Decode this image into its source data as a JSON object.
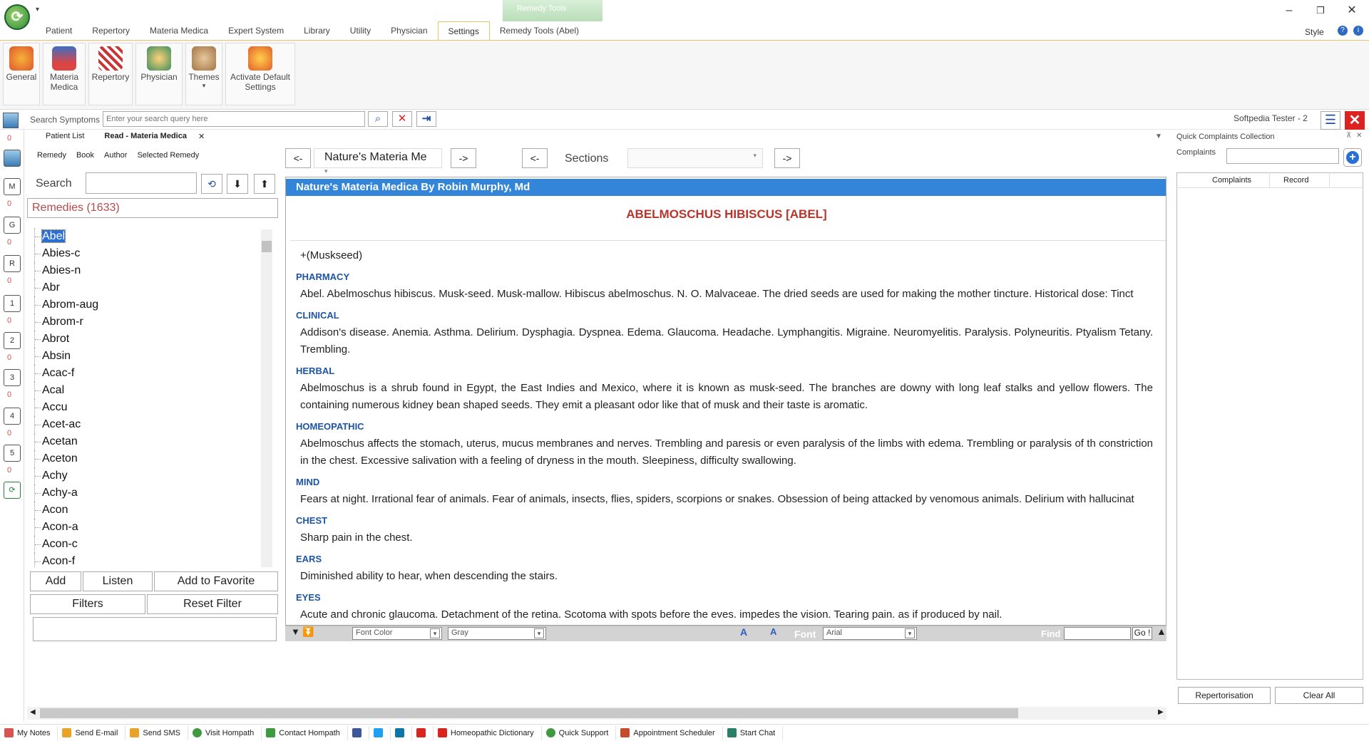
{
  "titlebar": {
    "context_tab": "Remedy Tools",
    "minimize": "–",
    "restore": "❐",
    "close": "✕"
  },
  "ribbon_tabs": [
    "Patient",
    "Repertory",
    "Materia Medica",
    "Expert System",
    "Library",
    "Utility",
    "Physician",
    "Settings",
    "Remedy Tools (Abel)"
  ],
  "active_tab": "Settings",
  "style_label": "Style",
  "ribbon_buttons": [
    {
      "label": "General"
    },
    {
      "label": "Materia Medica"
    },
    {
      "label": "Repertory"
    },
    {
      "label": "Physician"
    },
    {
      "label": "Themes"
    },
    {
      "label": "Activate Default Settings"
    }
  ],
  "search": {
    "label": "Search Symptoms",
    "placeholder": "Enter your search query here",
    "user": "Softpedia Tester - 2"
  },
  "left_strip": {
    "buttons": [
      "M",
      "G",
      "R",
      "1",
      "2",
      "3",
      "4",
      "5"
    ],
    "count": "0"
  },
  "doc_tabs": [
    "Patient List",
    "Read - Materia Medica"
  ],
  "remedy_panel": {
    "subtabs": [
      "Remedy",
      "Book",
      "Author",
      "Selected Remedy"
    ],
    "search_label": "Search",
    "count_label": "Remedies (1633)",
    "remedies": [
      "Abel",
      "Abies-c",
      "Abies-n",
      "Abr",
      "Abrom-aug",
      "Abrom-r",
      "Abrot",
      "Absin",
      "Acac-f",
      "Acal",
      "Accu",
      "Acet-ac",
      "Acetan",
      "Aceton",
      "Achy",
      "Achy-a",
      "Acon",
      "Acon-a",
      "Acon-c",
      "Acon-f"
    ],
    "selected": "Abel",
    "buttons": {
      "add": "Add",
      "listen": "Listen",
      "favorite": "Add to Favorite",
      "filters": "Filters",
      "reset": "Reset Filter"
    }
  },
  "reader": {
    "prev": "<-",
    "next": "->",
    "book_select": "Nature's Materia Me",
    "sections_label": "Sections",
    "book_header": "Nature's Materia Medica By Robin Murphy, Md",
    "remedy_title": "ABELMOSCHUS HIBISCUS [ABEL]",
    "aka": "+(Muskseed)",
    "sections": [
      {
        "heading": "PHARMACY",
        "text": "Abel. Abelmoschus hibiscus. Musk-seed. Musk-mallow. Hibiscus abelmoschus. N. O. Malvaceae. The dried seeds are used for making the mother tincture. Historical dose: Tinct"
      },
      {
        "heading": "CLINICAL",
        "text": "Addison's disease. Anemia. Asthma. Delirium. Dysphagia. Dyspnea. Edema. Glaucoma. Headache. Lymphangitis. Migraine. Neuromyelitis. Paralysis. Polyneuritis. Ptyalism Tetany. Trembling."
      },
      {
        "heading": "HERBAL",
        "text": "Abelmoschus is a shrub found in Egypt, the East Indies and Mexico, where it is known as musk-seed. The branches are downy with long leaf stalks and yellow flowers. The containing numerous kidney bean shaped seeds. They emit a pleasant odor like that of musk and their taste is aromatic."
      },
      {
        "heading": "HOMEOPATHIC",
        "text": "Abelmoschus affects the stomach, uterus, mucus membranes and nerves. Trembling and paresis or even paralysis of the limbs with edema. Trembling or paralysis of th constriction in the chest. Excessive salivation with a feeling of dryness in the mouth. Sleepiness, difficulty swallowing."
      },
      {
        "heading": "MIND",
        "text": "Fears at night. Irrational fear of animals. Fear of animals, insects, flies, spiders, scorpions or snakes. Obsession of being attacked by venomous animals. Delirium with hallucinat"
      },
      {
        "heading": "CHEST",
        "text": "Sharp pain in the chest."
      },
      {
        "heading": "EARS",
        "text": "Diminished ability to hear, when descending the stairs."
      },
      {
        "heading": "EYES",
        "text": "Acute and chronic glaucoma. Detachment of the retina. Scotoma with spots before the eves. impedes the vision. Tearing pain. as if produced by nail."
      }
    ],
    "toolbar": {
      "font_color": "Font Color",
      "color_value": "Gray",
      "font_label": "Font",
      "font_value": "Arial",
      "find_label": "Find",
      "go": "Go !"
    }
  },
  "quick_complaints": {
    "title": "Quick Complaints Collection",
    "complaints_label": "Complaints",
    "columns": [
      "Complaints",
      "Record"
    ],
    "repertorisation": "Repertorisation",
    "clear_all": "Clear All"
  },
  "statusbar": [
    {
      "label": "My Notes",
      "color": "#d9534f"
    },
    {
      "label": "Send E-mail",
      "color": "#e8a427"
    },
    {
      "label": "Send SMS",
      "color": "#e8a427"
    },
    {
      "label": "Visit Hompath",
      "color": "#3f9a3f"
    },
    {
      "label": "Contact Hompath",
      "color": "#3f9a3f"
    },
    {
      "label": "",
      "color": "#3b5998"
    },
    {
      "label": "",
      "color": "#1da1f2"
    },
    {
      "label": "",
      "color": "#0e76a8"
    },
    {
      "label": "",
      "color": "#d9251d"
    },
    {
      "label": "Homeopathic Dictionary",
      "color": "#d9251d"
    },
    {
      "label": "Quick Support",
      "color": "#3f9a3f"
    },
    {
      "label": "Appointment Scheduler",
      "color": "#c74a2a"
    },
    {
      "label": "Start Chat",
      "color": "#2a7f6a"
    }
  ]
}
